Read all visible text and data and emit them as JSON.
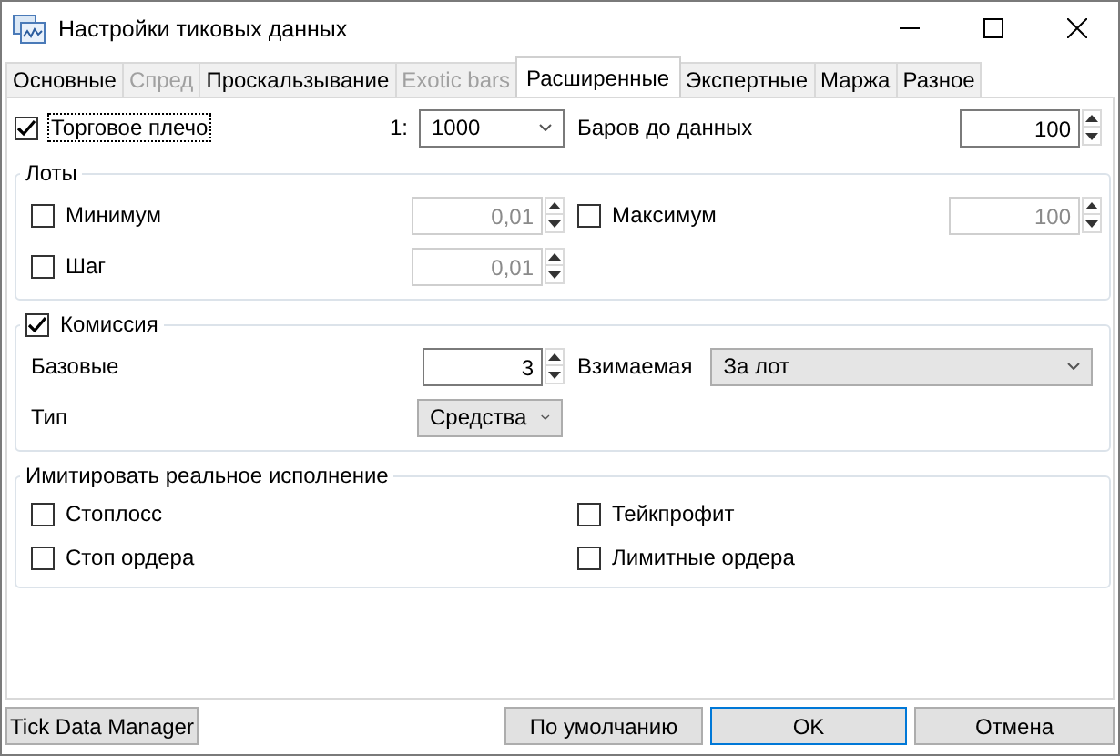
{
  "window": {
    "title": "Настройки тиковых данных"
  },
  "tabs": [
    {
      "label": "Основные",
      "selected": false,
      "disabled": false
    },
    {
      "label": "Спред",
      "selected": false,
      "disabled": true
    },
    {
      "label": "Проскальзывание",
      "selected": false,
      "disabled": false
    },
    {
      "label": "Exotic bars",
      "selected": false,
      "disabled": true
    },
    {
      "label": "Расширенные",
      "selected": true,
      "disabled": false
    },
    {
      "label": "Экспертные",
      "selected": false,
      "disabled": false
    },
    {
      "label": "Маржа",
      "selected": false,
      "disabled": false
    },
    {
      "label": "Разное",
      "selected": false,
      "disabled": false
    }
  ],
  "leverage": {
    "label": "Торговое плечо",
    "checked": true,
    "focused": true,
    "prefix": "1:",
    "value": "1000"
  },
  "bars_before_data": {
    "label": "Баров до данных",
    "value": "100"
  },
  "lots": {
    "title": "Лоты",
    "fields": [
      {
        "label": "Минимум",
        "checked": false,
        "value": "0,01",
        "disabled": true
      },
      {
        "label": "Максимум",
        "checked": false,
        "value": "100",
        "disabled": true
      },
      {
        "label": "Шаг",
        "checked": false,
        "value": "0,01",
        "disabled": true
      }
    ]
  },
  "commission": {
    "title": "Комиссия",
    "checked": true,
    "base": {
      "label": "Базовые",
      "value": "3"
    },
    "charged": {
      "label": "Взимаемая",
      "value": "За лот"
    },
    "type": {
      "label": "Тип",
      "value": "Средства"
    }
  },
  "simulate": {
    "title": "Имитировать реальное исполнение",
    "options": [
      {
        "label": "Стоплосс",
        "checked": false
      },
      {
        "label": "Тейкпрофит",
        "checked": false
      },
      {
        "label": "Стоп ордера",
        "checked": false
      },
      {
        "label": "Лимитные ордера",
        "checked": false
      }
    ]
  },
  "buttons": [
    {
      "label": "Tick Data Manager",
      "default": false
    },
    {
      "label": "По умолчанию",
      "default": false
    },
    {
      "label": "OK",
      "default": true
    },
    {
      "label": "Отмена",
      "default": false
    }
  ]
}
